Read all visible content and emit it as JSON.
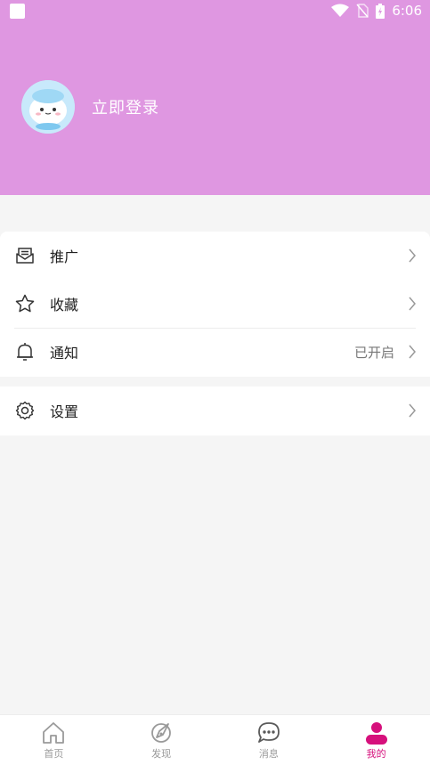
{
  "status_bar": {
    "time": "6:06"
  },
  "profile": {
    "login_label": "立即登录"
  },
  "menu": {
    "group1": [
      {
        "label": "推广",
        "icon": "envelope-icon"
      },
      {
        "label": "收藏",
        "icon": "star-icon"
      },
      {
        "label": "通知",
        "icon": "bell-icon",
        "value": "已开启"
      }
    ],
    "group2": [
      {
        "label": "设置",
        "icon": "gear-icon"
      }
    ]
  },
  "tabs": [
    {
      "label": "首页",
      "icon": "home-icon"
    },
    {
      "label": "发现",
      "icon": "compass-icon"
    },
    {
      "label": "消息",
      "icon": "chat-icon"
    },
    {
      "label": "我的",
      "icon": "user-icon",
      "active": true
    }
  ],
  "colors": {
    "header_bg": "#df97e1",
    "accent": "#d6107c"
  }
}
